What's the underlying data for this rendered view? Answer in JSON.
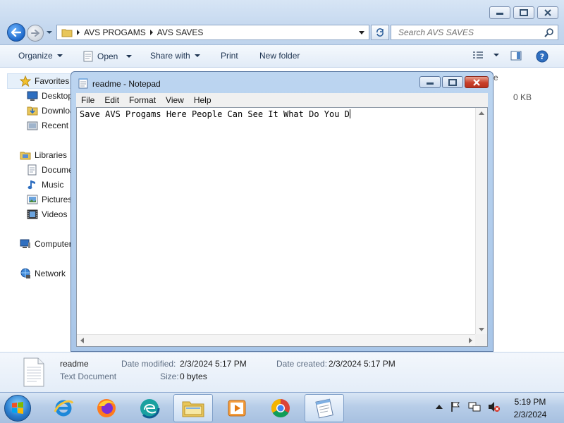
{
  "explorer": {
    "address": [
      "AVS PROGAMS",
      "AVS SAVES"
    ],
    "search_placeholder": "Search AVS SAVES",
    "toolbar": {
      "organize": "Organize",
      "open": "Open",
      "share_with": "Share with",
      "print": "Print",
      "new_folder": "New folder"
    },
    "nav": {
      "favorites": "Favorites",
      "desktop": "Desktop",
      "downloads": "Downloads",
      "recent": "Recent Places",
      "libraries": "Libraries",
      "documents": "Documents",
      "music": "Music",
      "pictures": "Pictures",
      "videos": "Videos",
      "computer": "Computer",
      "network": "Network"
    },
    "column_fragment": "e",
    "file_size_cell": "0 KB",
    "details": {
      "name": "readme",
      "type": "Text Document",
      "modified_label": "Date modified:",
      "modified_value": "2/3/2024 5:17 PM",
      "created_label": "Date created:",
      "created_value": "2/3/2024 5:17 PM",
      "size_label": "Size:",
      "size_value": "0 bytes"
    }
  },
  "notepad": {
    "title": "readme - Notepad",
    "menu": [
      "File",
      "Edit",
      "Format",
      "View",
      "Help"
    ],
    "content": "Save AVS Progams Here People Can See It What Do You D"
  },
  "taskbar": {
    "apps": [
      "internet-explorer",
      "firefox",
      "edge",
      "file-explorer",
      "media-player",
      "chrome",
      "notepad"
    ],
    "clock_time": "5:19 PM",
    "clock_date": "2/3/2024"
  }
}
